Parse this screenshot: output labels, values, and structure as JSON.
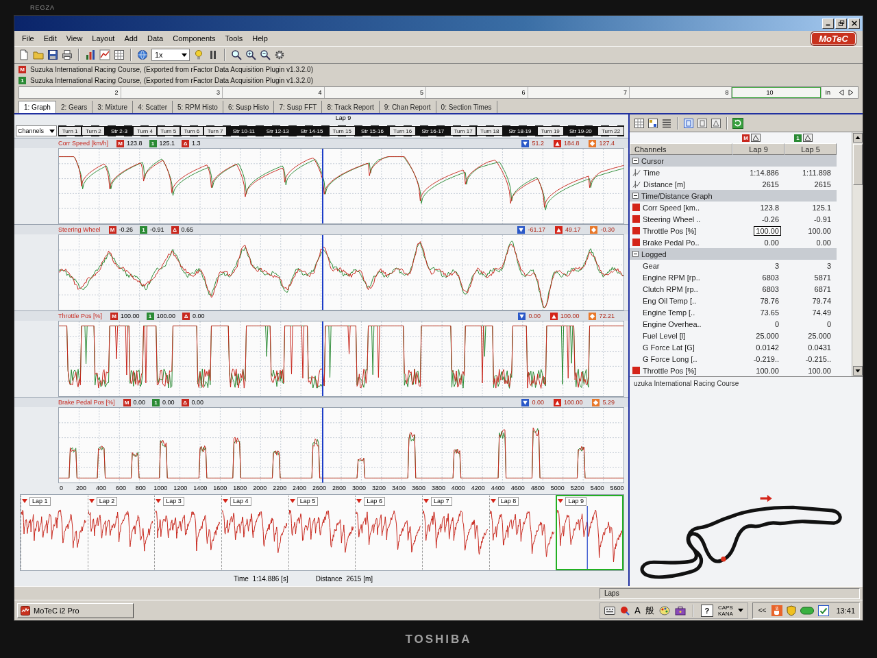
{
  "monitor": {
    "series": "REGZA",
    "brand": "TOSHIBA"
  },
  "app": {
    "logo": "MoTeC"
  },
  "menu": [
    "File",
    "Edit",
    "View",
    "Layout",
    "Add",
    "Data",
    "Components",
    "Tools",
    "Help"
  ],
  "toolbar": {
    "zoom": "1x"
  },
  "sessions": [
    {
      "marker": "M",
      "color": "#c8281e",
      "text": "Suzuka International Racing Course, (Exported from rFactor Data Acquisition Plugin v1.3.2.0)"
    },
    {
      "marker": "1",
      "color": "#2a8a34",
      "text": "Suzuka International Racing Course, (Exported from rFactor Data Acquisition Plugin v1.3.2.0)"
    }
  ],
  "ruler": {
    "labels": [
      "2",
      "3",
      "4",
      "5",
      "6",
      "7",
      "8"
    ],
    "range_label": "10",
    "end_label": "In"
  },
  "worksheets": [
    {
      "label": "1: Graph",
      "selected": true
    },
    {
      "label": "2: Gears",
      "selected": false
    },
    {
      "label": "3: Mixture",
      "selected": false
    },
    {
      "label": "4: Scatter",
      "selected": false
    },
    {
      "label": "5: RPM Histo",
      "selected": false
    },
    {
      "label": "6: Susp Histo",
      "selected": false
    },
    {
      "label": "7: Susp FFT",
      "selected": false
    },
    {
      "label": "8: Track Report",
      "selected": false
    },
    {
      "label": "9: Chan Report",
      "selected": false
    },
    {
      "label": "0: Section Times",
      "selected": false
    }
  ],
  "graph": {
    "channel_select": "Channels",
    "lap_label": "Lap 9",
    "cursor": {
      "level": 0.467
    },
    "sections": [
      {
        "label": "Turn 1",
        "kind": "turn"
      },
      {
        "label": "Turn 2",
        "kind": "turn"
      },
      {
        "label": "Str 2-3",
        "kind": "straight"
      },
      {
        "label": "Turn 4",
        "kind": "turn"
      },
      {
        "label": "Turn 5",
        "kind": "turn"
      },
      {
        "label": "Turn 6",
        "kind": "turn"
      },
      {
        "label": "Turn 7",
        "kind": "turn"
      },
      {
        "label": "Str 10-11",
        "kind": "straight"
      },
      {
        "label": "Str 12-13",
        "kind": "straight"
      },
      {
        "label": "Str 14-15",
        "kind": "straight"
      },
      {
        "label": "Turn 15",
        "kind": "turn"
      },
      {
        "label": "Str 15-16",
        "kind": "straight"
      },
      {
        "label": "Turn 16",
        "kind": "turn"
      },
      {
        "label": "Str 16-17",
        "kind": "straight"
      },
      {
        "label": "Turn 17",
        "kind": "turn"
      },
      {
        "label": "Turn 18",
        "kind": "turn"
      },
      {
        "label": "Str 18-19",
        "kind": "straight"
      },
      {
        "label": "Turn 19",
        "kind": "turn"
      },
      {
        "label": "Str 19-20",
        "kind": "straight"
      },
      {
        "label": "Turn 22",
        "kind": "turn"
      }
    ],
    "panes": [
      {
        "kind": "speed",
        "channel": "Corr Speed [km/h]",
        "readouts": [
          {
            "marker": "M",
            "color": "#c8281e",
            "text": "123.8"
          },
          {
            "marker": "1",
            "color": "#2a8a34",
            "text": "125.1"
          },
          {
            "marker": "Δ",
            "color": "#c8281e",
            "text": "1.3"
          }
        ],
        "stats": [
          {
            "kind": "min",
            "text": "51.2"
          },
          {
            "kind": "max",
            "text": "184.8"
          },
          {
            "kind": "avg",
            "text": "127.4"
          }
        ]
      },
      {
        "kind": "steering",
        "channel": "Steering Wheel",
        "readouts": [
          {
            "marker": "M",
            "color": "#c8281e",
            "text": "-0.26"
          },
          {
            "marker": "1",
            "color": "#2a8a34",
            "text": "-0.91"
          },
          {
            "marker": "Δ",
            "color": "#c8281e",
            "text": "0.65"
          }
        ],
        "stats": [
          {
            "kind": "min",
            "text": "-61.17"
          },
          {
            "kind": "max",
            "text": "49.17"
          },
          {
            "kind": "avg",
            "text": "-0.30"
          }
        ]
      },
      {
        "kind": "throttle",
        "channel": "Throttle Pos [%]",
        "readouts": [
          {
            "marker": "M",
            "color": "#c8281e",
            "text": "100.00"
          },
          {
            "marker": "1",
            "color": "#2a8a34",
            "text": "100.00"
          },
          {
            "marker": "Δ",
            "color": "#c8281e",
            "text": "0.00"
          }
        ],
        "stats": [
          {
            "kind": "min",
            "text": "0.00"
          },
          {
            "kind": "max",
            "text": "100.00"
          },
          {
            "kind": "avg",
            "text": "72.21"
          }
        ]
      },
      {
        "kind": "brake",
        "channel": "Brake Pedal Pos [%]",
        "readouts": [
          {
            "marker": "M",
            "color": "#c8281e",
            "text": "0.00"
          },
          {
            "marker": "1",
            "color": "#2a8a34",
            "text": "0.00"
          },
          {
            "marker": "Δ",
            "color": "#c8281e",
            "text": "0.00"
          }
        ],
        "stats": [
          {
            "kind": "min",
            "text": "0.00"
          },
          {
            "kind": "max",
            "text": "100.00"
          },
          {
            "kind": "avg",
            "text": "5.29"
          }
        ]
      }
    ],
    "distance_ticks": [
      "0",
      "200",
      "400",
      "600",
      "800",
      "1000",
      "1200",
      "1400",
      "1600",
      "1800",
      "2000",
      "2200",
      "2400",
      "2600",
      "2800",
      "3000",
      "3200",
      "3400",
      "3600",
      "3800",
      "4000",
      "4200",
      "4400",
      "4600",
      "4800",
      "5000",
      "5200",
      "5400",
      "5600"
    ]
  },
  "overview": {
    "laps": [
      {
        "label": "Lap 1",
        "selected": false
      },
      {
        "label": "Lap 2",
        "selected": false
      },
      {
        "label": "Lap 3",
        "selected": false
      },
      {
        "label": "Lap 4",
        "selected": false
      },
      {
        "label": "Lap 5",
        "selected": false
      },
      {
        "label": "Lap 6",
        "selected": false
      },
      {
        "label": "Lap 7",
        "selected": false
      },
      {
        "label": "Lap 8",
        "selected": false
      },
      {
        "label": "Lap 9",
        "selected": true
      }
    ]
  },
  "cursor_readout": {
    "time": "Time  1:14.886 [s]",
    "distance": "Distance  2615 [m]"
  },
  "channels_panel": {
    "title": "Channels",
    "laps": [
      {
        "marker": "M",
        "color": "#c8281e",
        "label": "Lap 9"
      },
      {
        "marker": "1",
        "color": "#2a8a34",
        "label": "Lap 5"
      }
    ],
    "groups": [
      {
        "title": "Cursor",
        "expanded": true,
        "rows": [
          {
            "kind": "cursor",
            "name": "Time",
            "values": [
              {
                "text": "1:14.886",
                "selected": false
              },
              {
                "text": "1:11.898",
                "selected": false
              }
            ]
          },
          {
            "kind": "cursor",
            "name": "Distance [m]",
            "values": [
              {
                "text": "2615",
                "selected": false
              },
              {
                "text": "2615",
                "selected": false
              }
            ]
          }
        ]
      },
      {
        "title": "Time/Distance Graph",
        "expanded": true,
        "rows": [
          {
            "kind": "channel",
            "name": "Corr Speed [km..",
            "color": "#d42418",
            "values": [
              {
                "text": "123.8",
                "selected": false
              },
              {
                "text": "125.1",
                "selected": false
              }
            ]
          },
          {
            "kind": "channel",
            "name": "Steering Wheel ..",
            "color": "#d42418",
            "values": [
              {
                "text": "-0.26",
                "selected": false
              },
              {
                "text": "-0.91",
                "selected": false
              }
            ]
          },
          {
            "kind": "channel",
            "name": "Throttle Pos [%]",
            "color": "#d42418",
            "values": [
              {
                "text": "100.00",
                "selected": true
              },
              {
                "text": "100.00",
                "selected": false
              }
            ]
          },
          {
            "kind": "channel",
            "name": "Brake Pedal Po..",
            "color": "#d42418",
            "values": [
              {
                "text": "0.00",
                "selected": false
              },
              {
                "text": "0.00",
                "selected": false
              }
            ]
          }
        ]
      },
      {
        "title": "Logged",
        "expanded": true,
        "rows": [
          {
            "kind": "channel",
            "name": "Gear",
            "values": [
              {
                "text": "3",
                "selected": false
              },
              {
                "text": "3",
                "selected": false
              }
            ]
          },
          {
            "kind": "channel",
            "name": "Engine RPM [rp..",
            "values": [
              {
                "text": "6803",
                "selected": false
              },
              {
                "text": "5871",
                "selected": false
              }
            ]
          },
          {
            "kind": "channel",
            "name": "Clutch RPM [rp..",
            "values": [
              {
                "text": "6803",
                "selected": false
              },
              {
                "text": "6871",
                "selected": false
              }
            ]
          },
          {
            "kind": "channel",
            "name": "Eng Oil Temp [..",
            "values": [
              {
                "text": "78.76",
                "selected": false
              },
              {
                "text": "79.74",
                "selected": false
              }
            ]
          },
          {
            "kind": "channel",
            "name": "Engine Temp [..",
            "values": [
              {
                "text": "73.65",
                "selected": false
              },
              {
                "text": "74.49",
                "selected": false
              }
            ]
          },
          {
            "kind": "channel",
            "name": "Engine Overhea..",
            "values": [
              {
                "text": "0",
                "selected": false
              },
              {
                "text": "0",
                "selected": false
              }
            ]
          },
          {
            "kind": "channel",
            "name": "Fuel Level [l]",
            "values": [
              {
                "text": "25.000",
                "selected": false
              },
              {
                "text": "25.000",
                "selected": false
              }
            ]
          },
          {
            "kind": "channel",
            "name": "G Force Lat [G]",
            "values": [
              {
                "text": "0.0142",
                "selected": false
              },
              {
                "text": "0.0431",
                "selected": false
              }
            ]
          },
          {
            "kind": "channel",
            "name": "G Force Long [..",
            "values": [
              {
                "text": "-0.219..",
                "selected": false
              },
              {
                "text": "-0.215..",
                "selected": false
              }
            ]
          },
          {
            "kind": "channel",
            "name": "Throttle Pos [%]",
            "color": "#d42418",
            "values": [
              {
                "text": "100.00",
                "selected": false
              },
              {
                "text": "100.00",
                "selected": false
              }
            ]
          }
        ]
      }
    ]
  },
  "track_map": {
    "title": "uzuka International Racing Course"
  },
  "status_bar": {
    "field": "Laps"
  },
  "taskbar": {
    "app_button": "MoTeC i2 Pro",
    "input_mode": "A",
    "conversion_mode": "般",
    "help": "?",
    "caps": "CAPS",
    "kana": "KANA",
    "expand": "<<",
    "clock": "13:41"
  }
}
